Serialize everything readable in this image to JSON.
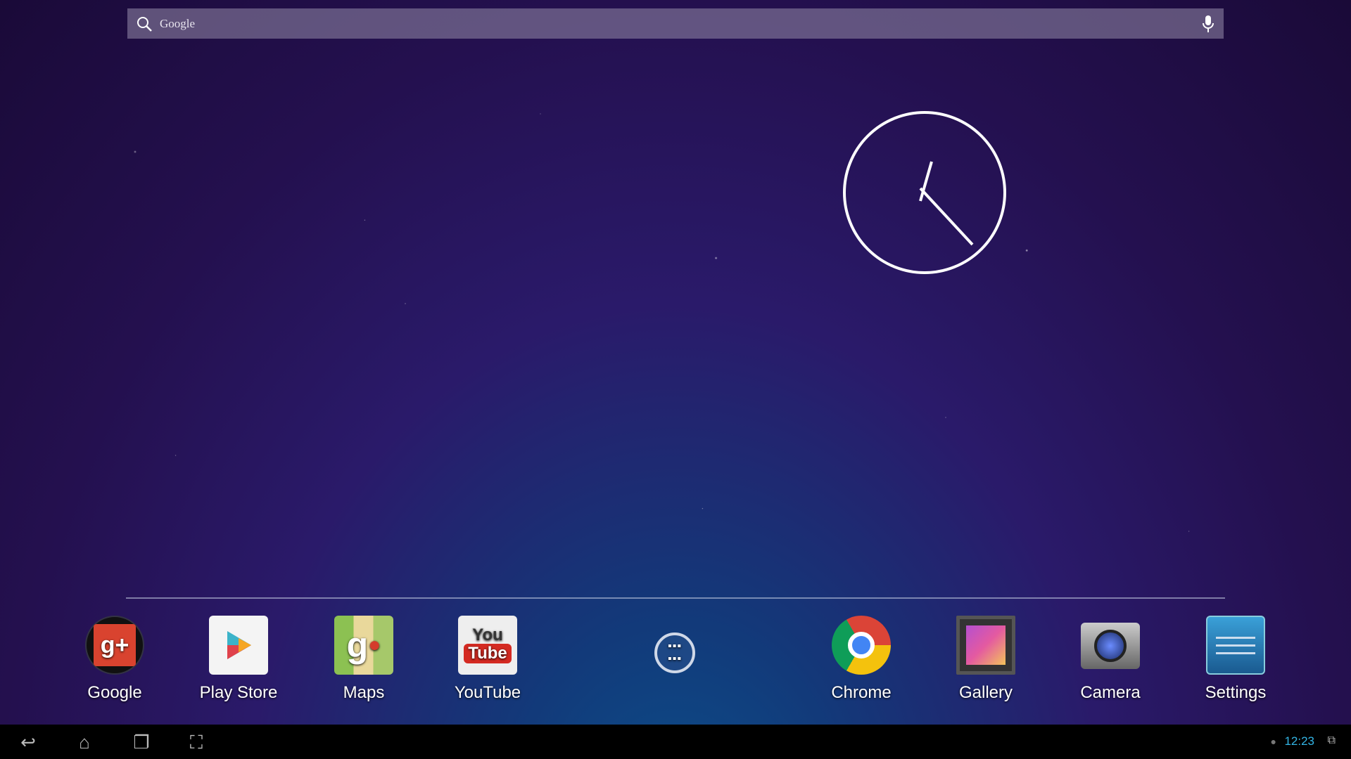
{
  "search": {
    "placeholder": "Google",
    "icon": "search-icon",
    "mic_icon": "microphone-icon"
  },
  "clock": {
    "type": "analog",
    "hour_hand": "~12:23"
  },
  "dock": {
    "apps": [
      {
        "label": "Google",
        "icon": "google-plus-icon"
      },
      {
        "label": "Play Store",
        "icon": "play-store-icon"
      },
      {
        "label": "Maps",
        "icon": "maps-icon"
      },
      {
        "label": "YouTube",
        "icon": "youtube-icon"
      },
      {
        "label": "",
        "icon": "all-apps-icon"
      },
      {
        "label": "Chrome",
        "icon": "chrome-icon"
      },
      {
        "label": "Gallery",
        "icon": "gallery-icon"
      },
      {
        "label": "Camera",
        "icon": "camera-icon"
      },
      {
        "label": "Settings",
        "icon": "settings-icon"
      }
    ]
  },
  "navbar": {
    "time": "12:23",
    "accent": "#33b5e5"
  }
}
